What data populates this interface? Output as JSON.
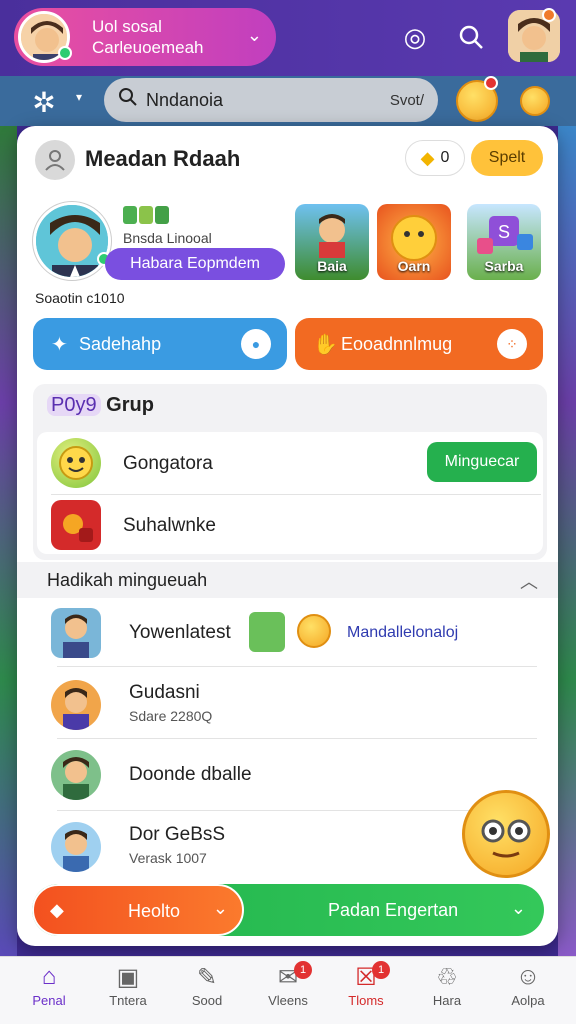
{
  "topbar": {
    "profile_line1": "Uol sosal",
    "profile_line2": "Carleuoemeah",
    "icons": [
      "chevron-down-icon",
      "target-icon",
      "search-icon",
      "avatar-icon"
    ]
  },
  "search": {
    "placeholder": "Nndanoia",
    "right_label": "Svot/"
  },
  "card": {
    "title": "Meadan Rdaah",
    "coins": "0",
    "spell_button": "Spelt",
    "profile_sub": "Bnsda Linooal",
    "profile_button": "Habara Eopmdem",
    "status": "Soaotin c1010",
    "games": [
      {
        "label": "Baia",
        "color": "#3fa0e0"
      },
      {
        "label": "Oarn",
        "color": "#e8531e"
      },
      {
        "label": "Sarba",
        "color": "#8f4fd8"
      }
    ],
    "action_left": "Sadehahp",
    "action_right": "Eooadnnlmug"
  },
  "group": {
    "title_prefix": "P0y9",
    "title": "Grup",
    "items": [
      {
        "name": "Gongatora",
        "action": "Minguecar"
      },
      {
        "name": "Suhalwnke"
      }
    ]
  },
  "recent": {
    "heading": "Hadikah mingueuah",
    "items": [
      {
        "name": "Yowenlatest",
        "link": "Mandallelonaloj"
      },
      {
        "name": "Gudasni",
        "sub": "Sdare 2280Q"
      },
      {
        "name": "Doonde dballe"
      },
      {
        "name": "Dor GeBsS",
        "sub": "Verask 1007"
      }
    ]
  },
  "bottom": {
    "left_button": "Heolto",
    "right_button": "Padan Engertan"
  },
  "tabs": [
    {
      "label": "Penal",
      "icon": "home-icon",
      "active": true
    },
    {
      "label": "Tntera",
      "icon": "bag-icon"
    },
    {
      "label": "Sood",
      "icon": "game-icon"
    },
    {
      "label": "Vleens",
      "icon": "message-icon",
      "badge": "1"
    },
    {
      "label": "Tloms",
      "icon": "inbox-icon",
      "badge": "1"
    },
    {
      "label": "Hara",
      "icon": "bell-icon"
    },
    {
      "label": "Aolpa",
      "icon": "profile-icon"
    }
  ],
  "colors": {
    "accent_purple": "#7a4fe0",
    "green": "#25b04e",
    "orange": "#f3511f",
    "blue": "#3a9be2"
  }
}
